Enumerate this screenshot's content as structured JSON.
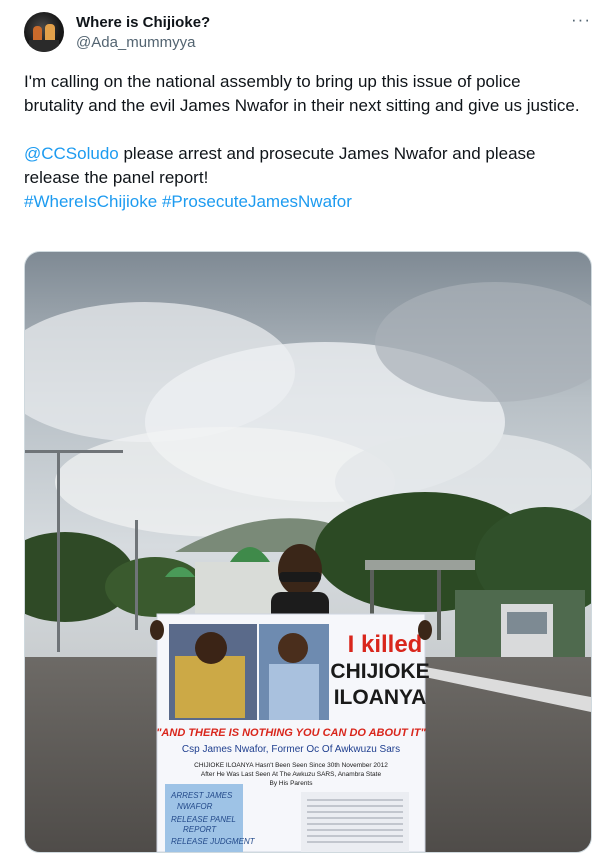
{
  "user": {
    "display_name": "Where is Chijioke?",
    "handle": "@Ada_mummyya",
    "avatar_icon": "profile-photo"
  },
  "more_icon": "···",
  "tweet": {
    "paragraph1": "I'm calling on the national assembly to bring up this issue of police brutality and the evil James Nwafor in their next sitting and give us justice.",
    "mention": "@CCSoludo",
    "paragraph2_rest": " please arrest and prosecute James Nwafor and please release the panel report!",
    "hashtag1": "#WhereIsChijioke",
    "hashtag2": "#ProsecuteJamesNwafor"
  },
  "poster": {
    "headline1": "I killed",
    "headline2": "CHIJIOKE",
    "headline3": "ILOANYA",
    "quote": "\"AND THERE IS NOTHING YOU CAN DO ABOUT IT\"",
    "attribution": "Csp James Nwafor, Former Oc Of Awkwuzu Sars",
    "detail1": "CHIJIOKE ILOANYA Hasn't Been Seen Since 30th November 2012",
    "detail2": "After He Was Last Seen At The Awkuzu SARS, Anambra State",
    "detail3": "By His Parents",
    "hand_note1": "ARREST JAMES",
    "hand_note2": "NWAFOR",
    "hand_note3": "RELEASE PANEL",
    "hand_note4": "REPORT",
    "hand_note5": "RELEASE JUDGMENT"
  },
  "colors": {
    "link": "#1d9bf0",
    "secondary_text": "#536471",
    "poster_red": "#d9261c",
    "poster_blue": "#1f3f8f"
  }
}
